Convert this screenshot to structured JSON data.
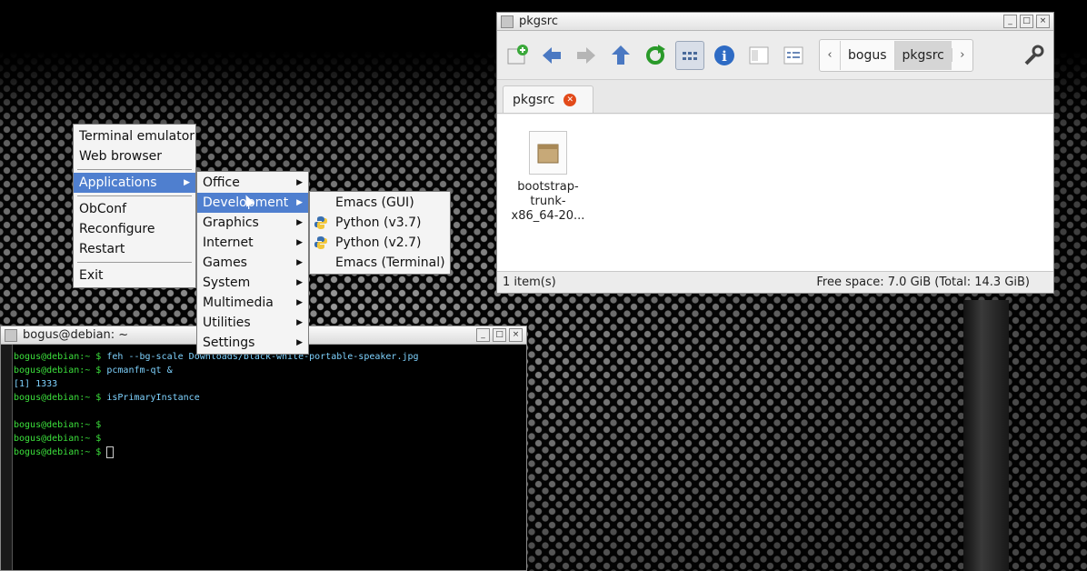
{
  "file_manager": {
    "title": "pkgsrc",
    "path": [
      "bogus",
      "pkgsrc"
    ],
    "tab_label": "pkgsrc",
    "file_name": "bootstrap-trunk-x86_64-20...",
    "status_left": "1 item(s)",
    "status_right": "Free space: 7.0 GiB (Total: 14.3 GiB)",
    "icons": [
      "new-tab-icon",
      "back-arrow-icon",
      "forward-arrow-icon",
      "up-arrow-icon",
      "reload-icon",
      "icon-view-icon",
      "info-icon",
      "compact-view-icon",
      "detailed-view-icon",
      "wrench-icon"
    ]
  },
  "root_menu": {
    "items": [
      "Terminal emulator",
      "Web browser",
      "Applications",
      "ObConf",
      "Reconfigure",
      "Restart",
      "Exit"
    ]
  },
  "apps_menu": {
    "items": [
      "Office",
      "Development",
      "Graphics",
      "Internet",
      "Games",
      "System",
      "Multimedia",
      "Utilities",
      "Settings"
    ]
  },
  "dev_menu": {
    "items": [
      "Emacs (GUI)",
      "Python (v3.7)",
      "Python (v2.7)",
      "Emacs (Terminal)"
    ]
  },
  "terminal": {
    "title": "bogus@debian: ~",
    "lines": [
      {
        "prompt": "bogus@debian:~ $ ",
        "text": "feh --bg-scale Downloads/black-white-portable-speaker.jpg"
      },
      {
        "prompt": "bogus@debian:~ $ ",
        "text": "pcmanfm-qt &"
      },
      {
        "prompt": "",
        "text": "[1] 1333"
      },
      {
        "prompt": "bogus@debian:~ $ ",
        "text": "isPrimaryInstance"
      },
      {
        "prompt": "",
        "text": ""
      },
      {
        "prompt": "bogus@debian:~ $ ",
        "text": ""
      },
      {
        "prompt": "bogus@debian:~ $ ",
        "text": ""
      },
      {
        "prompt": "bogus@debian:~ $ ",
        "text": ""
      }
    ]
  },
  "colors": {
    "menu_highlight": "#4f7fcf",
    "prompt_green": "#3ce03c",
    "terminal_text": "#7fd3ff"
  }
}
